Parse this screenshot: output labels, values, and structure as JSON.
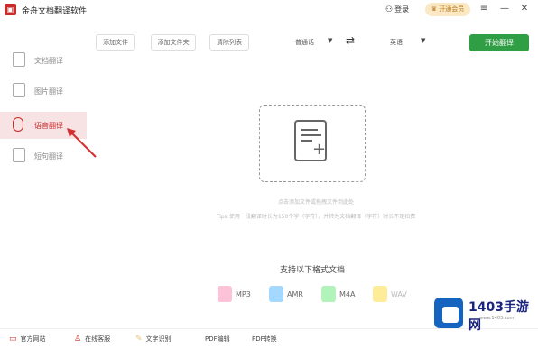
{
  "titlebar": {
    "app_title": "金舟文档翻译软件",
    "login_label": "登录",
    "vip_label": "开通会员"
  },
  "toolbar": {
    "add_file": "添加文件",
    "add_folder": "添加文件夹",
    "clear_list": "清除列表",
    "source_lang": "普通话",
    "target_lang": "英语",
    "start_button": "开始翻译"
  },
  "sidebar": {
    "items": [
      {
        "label": "文档翻译",
        "active": false
      },
      {
        "label": "图片翻译",
        "active": false
      },
      {
        "label": "语音翻译",
        "active": true
      },
      {
        "label": "短句翻译",
        "active": false
      }
    ]
  },
  "main": {
    "hint_line1": "点击添加文件或拖拽文件到此处",
    "hint_line2": "Tips:使用一段翻译时长为150个字（字符），并转为文档翻译（字符）时长不足扣费",
    "formats_title": "支持以下格式文档",
    "formats": [
      {
        "label": "MP3",
        "color": "#e64980"
      },
      {
        "label": "AMR",
        "color": "#1c7ed6"
      },
      {
        "label": "M4A",
        "color": "#40c057"
      },
      {
        "label": "WAV",
        "color": "#fab005"
      }
    ]
  },
  "footer": {
    "items": [
      {
        "label": "官方网站",
        "icon": "monitor-icon"
      },
      {
        "label": "在线客服",
        "icon": "person-icon"
      },
      {
        "label": "文字识别",
        "icon": "scan-icon"
      },
      {
        "label": "PDF编辑",
        "icon": ""
      },
      {
        "label": "PDF转换",
        "icon": ""
      }
    ]
  },
  "watermark": {
    "title": "1403手游网",
    "url": "www.1403.com"
  }
}
